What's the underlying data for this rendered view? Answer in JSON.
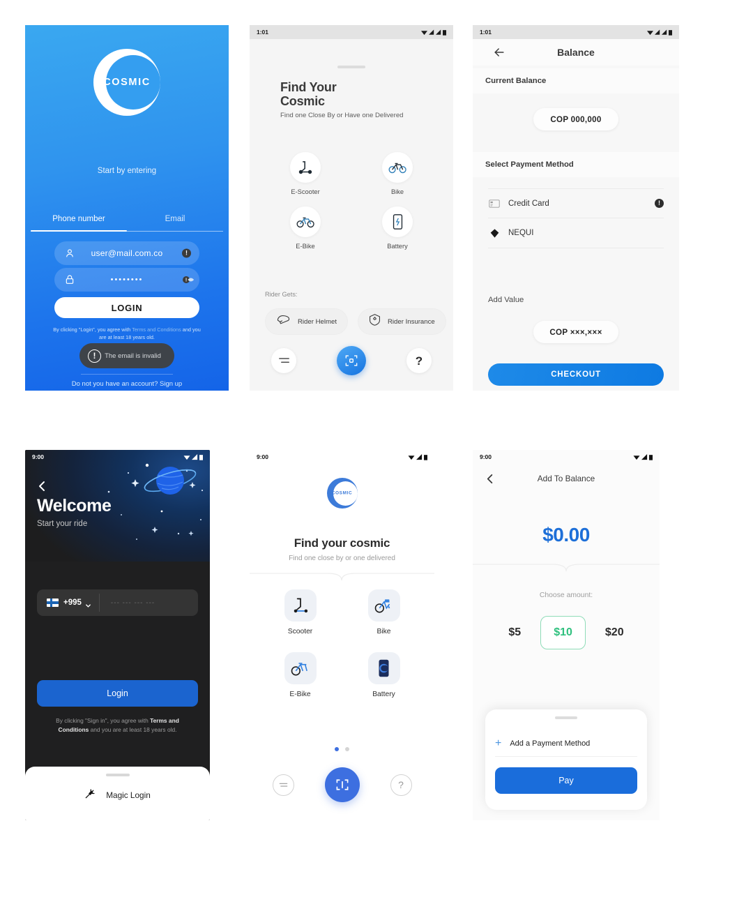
{
  "screens": {
    "login": {
      "logo_text": "COSMIC",
      "start_by": "Start by entering",
      "tabs": [
        {
          "label": "Phone number",
          "active": true
        },
        {
          "label": "Email",
          "active": false
        }
      ],
      "email_field": {
        "value": "user@mail.com.co",
        "icon": "user-icon",
        "badge": "!"
      },
      "password_field": {
        "value": "••••••••",
        "icon": "lock-icon",
        "badge": "!"
      },
      "login_button": "LOGIN",
      "terms_prefix": "By clicking \"Login\", you agree with ",
      "terms_link": "Terms and Conditions",
      "terms_suffix": " and you are at least 18 years old.",
      "error_toast": "The email is invalid",
      "signup": "Do not you have an account? Sign up"
    },
    "find_cosmic_1": {
      "status_time": "1:01",
      "title": "Find Your\nCosmic",
      "title_line1": "Find Your",
      "title_line2": "Cosmic",
      "subtitle": "Find one Close By or Have one Delivered",
      "vehicles": [
        {
          "label": "E-Scooter",
          "icon": "scooter-icon"
        },
        {
          "label": "Bike",
          "icon": "bike-icon"
        },
        {
          "label": "E-Bike",
          "icon": "ebike-icon"
        },
        {
          "label": "Battery",
          "icon": "battery-icon"
        }
      ],
      "rider_gets_label": "Rider Gets:",
      "chips": [
        {
          "label": "Rider Helmet",
          "icon": "helmet-icon"
        },
        {
          "label": "Rider Insurance",
          "icon": "shield-icon"
        }
      ],
      "nav": [
        {
          "name": "menu-icon"
        },
        {
          "name": "scan-icon"
        },
        {
          "name": "help-icon",
          "label": "?"
        }
      ]
    },
    "balance": {
      "status_time": "1:01",
      "title": "Balance",
      "back_icon": "arrow-left-icon",
      "section_current_balance": "Current Balance",
      "balance_value": "COP 000,000",
      "section_select_payment": "Select Payment Method",
      "payment_methods": [
        {
          "label": "Credit Card",
          "icon": "credit-card-icon",
          "info": "!"
        },
        {
          "label": "NEQUI",
          "icon": "nequi-diamond-icon",
          "info": ""
        }
      ],
      "add_value_label": "Add Value",
      "add_value": "COP ×××,×××",
      "checkout_button": "CHECKOUT"
    },
    "welcome": {
      "status_time": "9:00",
      "back_icon": "chevron-left-icon",
      "title": "Welcome",
      "subtitle": "Start your ride",
      "country_code": "+995",
      "flag": "finland-flag-icon",
      "phone_placeholder": "--- --- --- ---",
      "login_button": "Login",
      "terms_prefix": "By clicking \"Sign in\", you agree with ",
      "terms_link": "Terms and Conditions",
      "terms_suffix": " and you are at least 18 years old.",
      "magic_login": "Magic Login",
      "magic_icon": "magic-wand-icon"
    },
    "find_cosmic_2": {
      "status_time": "9:00",
      "logo_text": "COSMIC",
      "title": "Find your cosmic",
      "subtitle": "Find one close by or one delivered",
      "vehicles": [
        {
          "label": "Scooter",
          "icon": "scooter-icon"
        },
        {
          "label": "Bike",
          "icon": "bike-icon"
        },
        {
          "label": "E-Bike",
          "icon": "ebike-icon"
        },
        {
          "label": "Battery",
          "icon": "battery-phone-icon"
        }
      ],
      "page_dots": 2,
      "active_dot": 0,
      "nav": [
        {
          "name": "menu-icon"
        },
        {
          "name": "scan-icon"
        },
        {
          "name": "help-icon",
          "label": "?"
        }
      ]
    },
    "add_to_balance": {
      "status_time": "9:00",
      "back_icon": "chevron-left-icon",
      "title": "Add To Balance",
      "amount": "$0.00",
      "choose_amount_label": "Choose amount:",
      "amount_options": [
        {
          "label": "$5",
          "selected": false
        },
        {
          "label": "$10",
          "selected": true
        },
        {
          "label": "$20",
          "selected": false
        }
      ],
      "add_payment_method": "Add a Payment Method",
      "pay_button": "Pay"
    }
  },
  "colors": {
    "login_blue": "#2f93ee",
    "accent_blue": "#1d6fd8",
    "fab_blue": "#3d6fe0",
    "selected_green": "#2fc07e",
    "dark_bg": "#1f1f20",
    "toast_dark": "#3e4349"
  }
}
